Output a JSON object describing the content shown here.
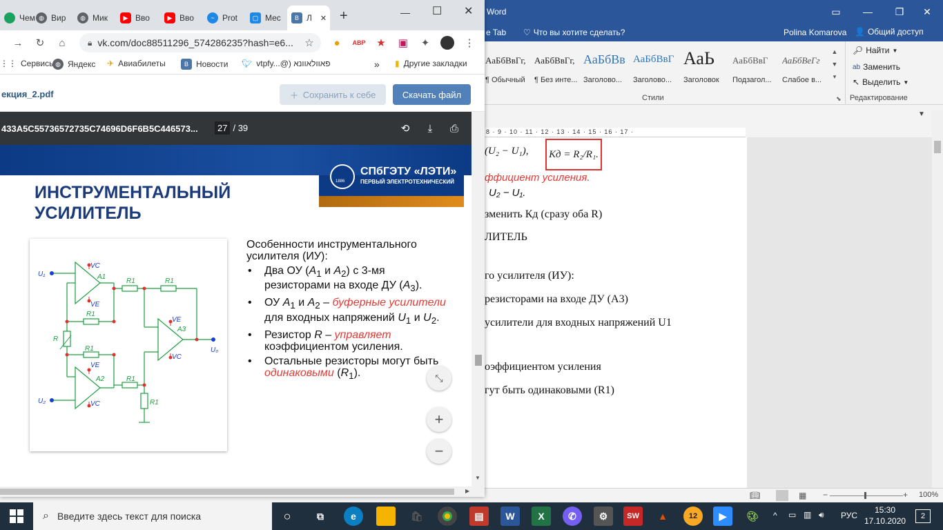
{
  "word": {
    "title_fragment": "Word",
    "tab_fragment": "e Tab",
    "tell_me": "Что вы хотите сделать?",
    "user": "Polina Komarova",
    "share": "Общий доступ",
    "styles": [
      {
        "preview": "АаБбВвГг,",
        "name": "¶ Обычный"
      },
      {
        "preview": "АаБбВвГг,",
        "name": "¶ Без инте..."
      },
      {
        "preview": "АаБбВв",
        "name": "Заголово..."
      },
      {
        "preview": "АаБбВвГ",
        "name": "Заголово..."
      },
      {
        "preview": "АаЬ",
        "name": "Заголовок"
      },
      {
        "preview": "АаБбВвГ",
        "name": "Подзагол..."
      },
      {
        "preview": "АаБбВеГг",
        "name": "Слабое в..."
      }
    ],
    "styles_group_label": "Стили",
    "edit": {
      "find": "Найти",
      "replace": "Заменить",
      "select": "Выделить",
      "group_label": "Редактирование"
    },
    "ruler": "8 · 9 · 10 · 11 · 12 · 13 · 14 · 15 · 16 · 17 ·",
    "doc_lines": [
      "ффициент усиления.",
      "U₂ − U₁.",
      "зменить Кд (сразу оба R)",
      "ЛИТЕЛЬ",
      "го усилителя (ИУ):",
      "резисторами на входе ДУ (А3)",
      "усилители для входных напряжений U1",
      "оэффициентом усиления",
      "гут быть одинаковыми (R1)"
    ],
    "formula_left": "(U₂ − U₁),",
    "formula_box": "Кд = R₂/R₁.",
    "zoom": "100%"
  },
  "chrome": {
    "tabs": [
      {
        "label": "Чем",
        "icon": "chrome-icon",
        "color": "#1aa260"
      },
      {
        "label": "Вир",
        "icon": "globe-icon",
        "color": "#5f6368"
      },
      {
        "label": "Мик",
        "icon": "globe-icon",
        "color": "#5f6368"
      },
      {
        "label": "Вво",
        "icon": "youtube-icon",
        "color": "#ff0000"
      },
      {
        "label": "Вво",
        "icon": "youtube-icon",
        "color": "#ff0000"
      },
      {
        "label": "Prot",
        "icon": "wave-icon",
        "color": "#1e88e5"
      },
      {
        "label": "Мес",
        "icon": "chat-icon",
        "color": "#1e88e5"
      },
      {
        "label": "Л",
        "icon": "vk-icon",
        "color": "#4a76a8"
      }
    ],
    "new_tab": "+",
    "url": "vk.com/doc88511296_574286235?hash=e6...",
    "bookmarks": [
      {
        "label": "Сервисы",
        "icon": "apps-icon"
      },
      {
        "label": "Яндекс",
        "icon": "globe-icon"
      },
      {
        "label": "Авиабилеты",
        "icon": "plane-icon"
      },
      {
        "label": "Новости",
        "icon": "vk-icon"
      },
      {
        "label": "vtpfy...@) פאוולאוונא",
        "icon": "twitter-icon"
      }
    ],
    "bookmarks_more": "»",
    "other_bookmarks": "Другие закладки"
  },
  "vk": {
    "filename": "екция_2.pdf",
    "save_label": "Сохранить к себе",
    "download_label": "Скачать файл"
  },
  "pdf": {
    "title": "433A5C55736572735C74696D6F6B5C446573...",
    "page_current": "27",
    "page_total": "/ 39"
  },
  "slide": {
    "logo": "СПбГЭТУ «ЛЭТИ»",
    "logo_sub": "ПЕРВЫЙ ЭЛЕКТРОТЕХНИЧЕСКИЙ",
    "logo_year": "1886",
    "title": "ИНСТРУМЕНТАЛЬНЫЙ УСИЛИТЕЛЬ",
    "intro": "Особенности инструментального усилителя (ИУ):",
    "circuit_labels": {
      "u1": "U₁",
      "u2": "U₂",
      "u0": "U₀",
      "a1": "A1",
      "a2": "A2",
      "a3": "A3",
      "r1": "R1",
      "r": "R",
      "vc": "VC",
      "ve": "VE"
    },
    "bullets": [
      {
        "pre": "Два ОУ (",
        "it1": "A",
        "sub1": "1",
        "mid": " и ",
        "it2": "A",
        "sub2": "2",
        "post": ") с 3-мя резисторами на входе ДУ (",
        "it3": "A",
        "sub3": "3",
        "end": ")."
      },
      {
        "pre": "ОУ ",
        "it1": "A",
        "sub1": "1",
        "mid": " и ",
        "it2": "A",
        "sub2": "2",
        "dash": " – ",
        "red": "буферные усилители",
        "post": " для входных напряжений ",
        "it3": "U",
        "sub3": "1",
        "and": " и ",
        "it4": "U",
        "sub4": "2",
        "end": "."
      },
      {
        "pre": "Резистор ",
        "it1": "R",
        "dash": " – ",
        "red": "управляет",
        "post": " коэффициентом усиления."
      },
      {
        "pre": "Остальные резисторы могут быть ",
        "red": "одинаковыми",
        "post": " (",
        "it1": "R",
        "sub1": "1",
        "end": ")."
      }
    ]
  },
  "taskbar": {
    "search_placeholder": "Введите здесь текст для поиска",
    "lang": "РУС",
    "time": "15:30",
    "date": "17.10.2020",
    "notif_count": "2"
  }
}
